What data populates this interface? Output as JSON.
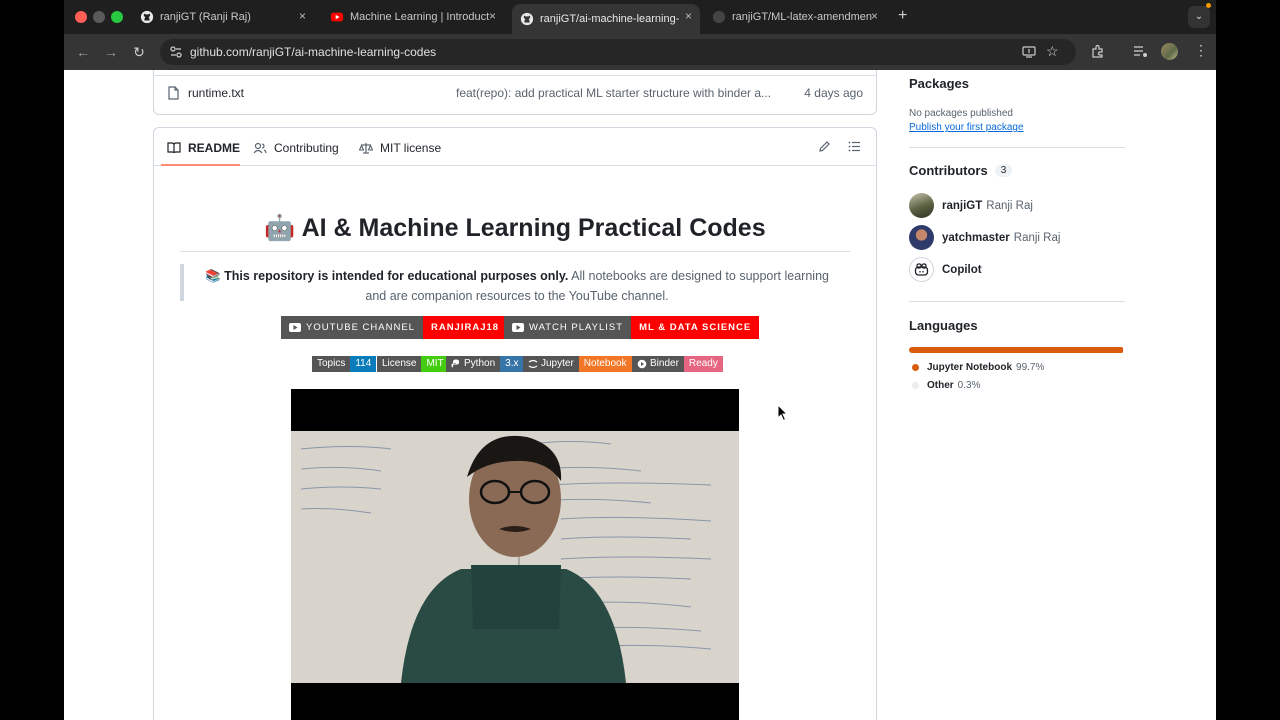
{
  "browser": {
    "tabs": [
      {
        "title": "ranjiGT (Ranji Raj)",
        "favicon": "github-icon"
      },
      {
        "title": "Machine Learning | Introductio",
        "favicon": "youtube-icon"
      },
      {
        "title": "ranjiGT/ai-machine-learning-",
        "favicon": "github-icon",
        "active": true
      },
      {
        "title": "ranjiGT/ML-latex-amendment",
        "favicon": "github-icon"
      }
    ],
    "new_tab": "+",
    "close_glyph": "×",
    "url": "github.com/ranjiGT/ai-machine-learning-codes"
  },
  "file_row": {
    "name": "runtime.txt",
    "commit": "feat(repo): add practical ML starter structure with binder a...",
    "age": "4 days ago"
  },
  "readme_tabs": [
    "README",
    "Contributing",
    "MIT license"
  ],
  "readme": {
    "emoji": "🤖",
    "title": "AI & Machine Learning Practical Codes",
    "note_emoji": "📚",
    "note_bold": "This repository is intended for educational purposes only.",
    "note_rest": "All notebooks are designed to support learning",
    "note_line2": "and are companion resources to the YouTube channel.",
    "big_badges": [
      {
        "left": "YOUTUBE CHANNEL",
        "right": "RANJIRAJ18"
      },
      {
        "left": "WATCH PLAYLIST",
        "right": "ML & DATA SCIENCE"
      }
    ],
    "shields": [
      {
        "label": "Topics",
        "value": "114",
        "color": "#0a7bbb"
      },
      {
        "label": "License",
        "value": "MIT",
        "color": "#4c1"
      },
      {
        "label": "Python",
        "value": "3.x",
        "color": "#3775a9"
      },
      {
        "label": "Jupyter",
        "value": "Notebook",
        "color": "#f37626"
      },
      {
        "label": "Binder",
        "value": "Ready",
        "color": "#e66581"
      }
    ]
  },
  "sidebar": {
    "packages_heading": "Packages",
    "packages_text": "No packages published",
    "packages_link": "Publish your first package",
    "contributors_heading": "Contributors",
    "contributors_count": "3",
    "contributors": [
      {
        "login": "ranjiGT",
        "name": "Ranji Raj"
      },
      {
        "login": "yatchmaster",
        "name": "Ranji Raj"
      },
      {
        "login": "Copilot",
        "name": ""
      }
    ],
    "languages_heading": "Languages",
    "languages": [
      {
        "name": "Jupyter Notebook",
        "pct": "99.7%",
        "color": "#DA5B0B"
      },
      {
        "name": "Other",
        "pct": "0.3%",
        "color": "#ededed"
      }
    ]
  }
}
